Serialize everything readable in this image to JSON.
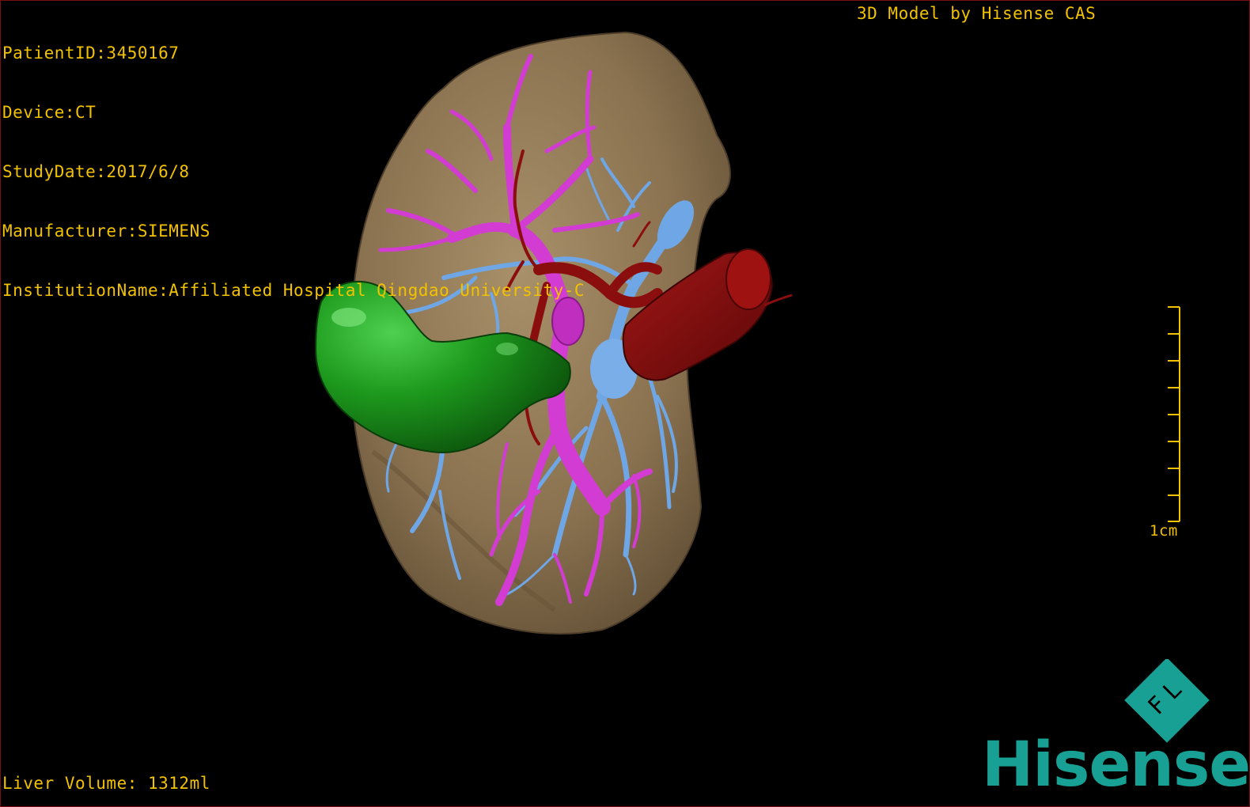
{
  "overlay": {
    "patient_id": "PatientID:3450167",
    "device": "Device:CT",
    "study_date": "StudyDate:2017/6/8",
    "manufacturer": "Manufacturer:SIEMENS",
    "institution": "InstitutionName:Affiliated Hospital Qingdao University-C",
    "credit": "3D Model by Hisense CAS",
    "liver_volume": "Liver Volume: 1312ml",
    "scale_label": "1cm"
  },
  "brand": {
    "name": "Hisense",
    "mark_letters": "F L"
  },
  "colors": {
    "overlay_text": "#f2c200",
    "liver": "#8c7452",
    "gallbladder": "#1d8a1d",
    "portal_vein": "#d23cd2",
    "hepatic_vein": "#6fa6e6",
    "artery": "#8b0e0e",
    "brand": "#17a093"
  }
}
